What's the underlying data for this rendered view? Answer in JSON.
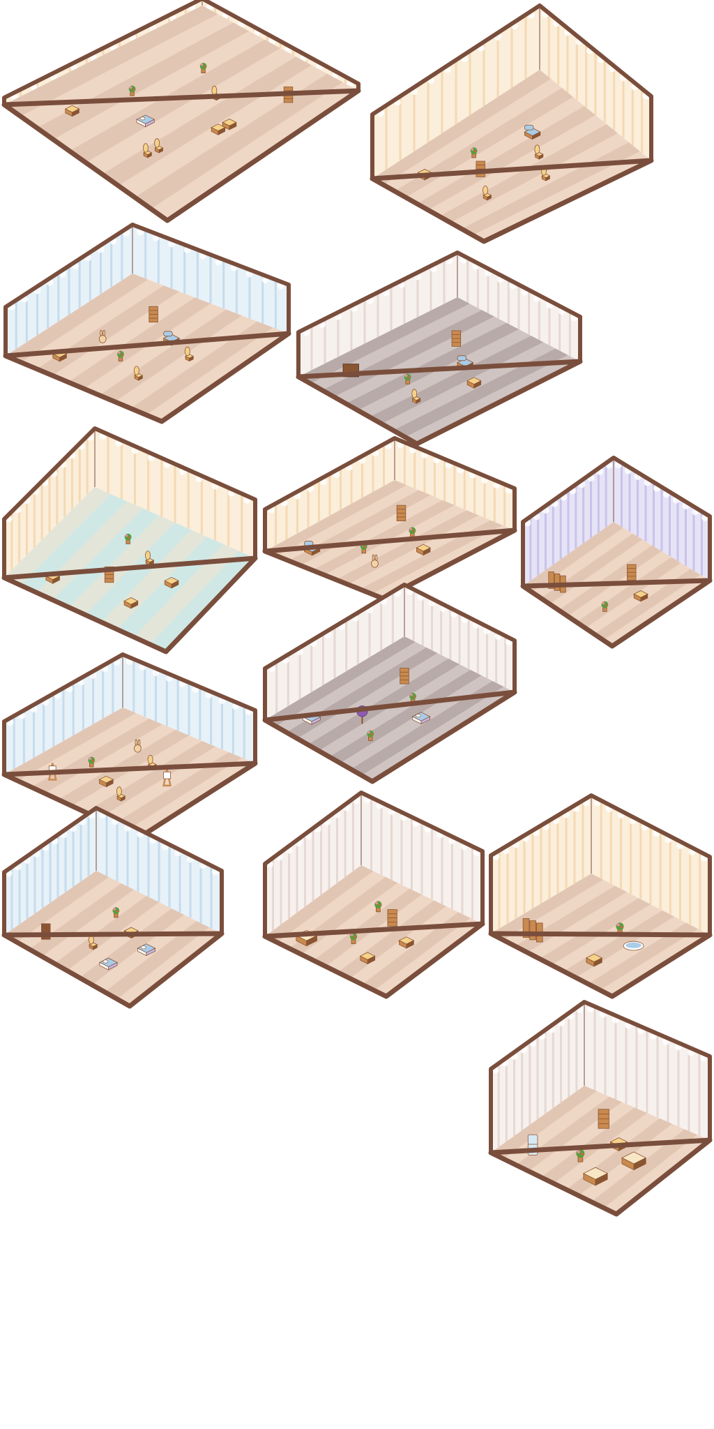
{
  "palette": {
    "frame": "#7a4e3c",
    "wall_cream": "#fbeeda",
    "wall_cream_stripe": "#f4d9b4",
    "wall_blue": "#e7f1f8",
    "wall_blue_stripe": "#c6dcec",
    "wall_lavender": "#e6e3f6",
    "wall_lavender_stripe": "#c9c3ea",
    "wall_white": "#f7f1ee",
    "wall_white_stripe": "#e6d8d2",
    "floor_stripe_a": "#efd7c6",
    "floor_stripe_b": "#d8bba8",
    "floor_gray_a": "#cfc4c1",
    "floor_gray_b": "#a9999a",
    "floor_teal_a": "#cfe8e6",
    "floor_teal_b": "#f0e2cf",
    "wood": "#c98a4f",
    "wood_dark": "#8a5532",
    "cushion_gold": "#f5d28a",
    "cushion_blue": "#a9cce8",
    "cushion_lilac": "#c7b6e6",
    "leaf": "#5a9e3c",
    "flower_pink": "#f28db1",
    "flower_red": "#e4584f"
  },
  "rooms": [
    {
      "name": "room-overview-house",
      "wall": "cream",
      "floor": "stripe",
      "furniture": [
        "table",
        "table",
        "chair",
        "chair",
        "bed",
        "plant",
        "plant",
        "shelf",
        "table",
        "chair"
      ]
    },
    {
      "name": "room-cafe-lounge",
      "wall": "cream",
      "floor": "stripe",
      "furniture": [
        "table",
        "chair",
        "chair",
        "chair",
        "shelf",
        "sofa",
        "plant"
      ]
    },
    {
      "name": "room-blue-cafe",
      "wall": "blue",
      "floor": "stripe",
      "furniture": [
        "table",
        "chair",
        "chair",
        "sofa",
        "plant",
        "shelf",
        "bunny"
      ]
    },
    {
      "name": "room-piano-lounge",
      "wall": "white",
      "floor": "gray",
      "furniture": [
        "piano",
        "table",
        "chair",
        "sofa",
        "plant",
        "cabinet"
      ]
    },
    {
      "name": "room-striped-dining",
      "wall": "cream",
      "floor": "teal",
      "furniture": [
        "table",
        "table",
        "table",
        "chair",
        "shelf",
        "plant"
      ]
    },
    {
      "name": "room-garden-kitchen",
      "wall": "cream",
      "floor": "stripe",
      "furniture": [
        "sofa",
        "table",
        "bunny",
        "plant",
        "plant",
        "shelf"
      ]
    },
    {
      "name": "room-lavender-bath",
      "wall": "lavender",
      "floor": "stripe",
      "furniture": [
        "screen",
        "table",
        "plant",
        "shelf"
      ]
    },
    {
      "name": "room-easel-studio",
      "wall": "blue",
      "floor": "stripe",
      "furniture": [
        "easel",
        "easel",
        "chair",
        "chair",
        "table",
        "bunny",
        "plant"
      ]
    },
    {
      "name": "room-pastel-bedroom",
      "wall": "white",
      "floor": "gray",
      "furniture": [
        "bed",
        "bed",
        "plant",
        "plant",
        "tree",
        "shelf"
      ]
    },
    {
      "name": "room-library-bedroom",
      "wall": "blue",
      "floor": "stripe",
      "furniture": [
        "bookshelf",
        "bed",
        "bed",
        "table",
        "chair",
        "plant"
      ]
    },
    {
      "name": "room-bakery-shop",
      "wall": "white",
      "floor": "stripe",
      "furniture": [
        "counter",
        "table",
        "table",
        "cabinet",
        "plant",
        "plant"
      ]
    },
    {
      "name": "room-cream-bathroom",
      "wall": "cream",
      "floor": "stripe",
      "furniture": [
        "screen",
        "bathtub",
        "table",
        "plant"
      ]
    },
    {
      "name": "room-blue-kitchen",
      "wall": "white",
      "floor": "stripe",
      "furniture": [
        "fridge",
        "counter",
        "counter",
        "table",
        "plant",
        "shelf"
      ]
    }
  ]
}
